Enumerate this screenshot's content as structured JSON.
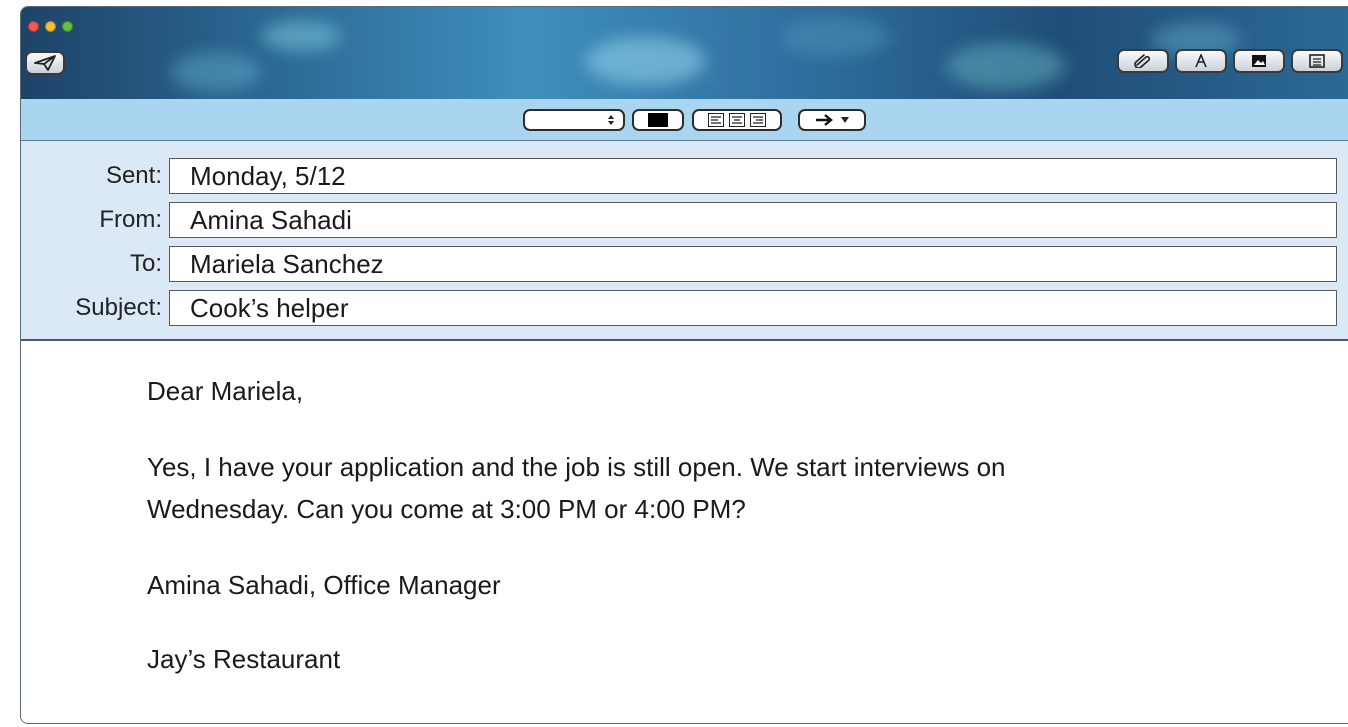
{
  "toolbar": {
    "send_icon": "paper-plane-icon",
    "right_buttons": [
      "paperclip-icon",
      "signature-icon",
      "photo-icon",
      "grid-icon"
    ]
  },
  "format_bar": {
    "font_select_value": "",
    "color_icon": "color-swatch-icon",
    "alignment_icons": [
      "align-left-icon",
      "align-center-icon",
      "align-right-icon"
    ],
    "indent_icon": "indent-arrow-icon"
  },
  "headers": {
    "sent_label": "Sent:",
    "sent_value": "Monday, 5/12",
    "from_label": "From:",
    "from_value": "Amina Sahadi",
    "to_label": "To:",
    "to_value": "Mariela Sanchez",
    "subject_label": "Subject:",
    "subject_value": "Cook’s helper"
  },
  "message": {
    "greeting": "Dear Mariela,",
    "paragraph_line1": "Yes, I have your application and the job is still open. We start interviews on",
    "paragraph_line2": "Wednesday. Can you come at 3:00 PM or 4:00 PM?",
    "signature_name": "Amina Sahadi, Office Manager",
    "signature_company": "Jay’s Restaurant"
  },
  "colors": {
    "traffic_close": "#ee5a52",
    "traffic_minimize": "#f5bf2f",
    "traffic_zoom": "#5fc43f",
    "format_bar_bg": "#a9d5f1",
    "header_bg": "#dbe9f6"
  }
}
